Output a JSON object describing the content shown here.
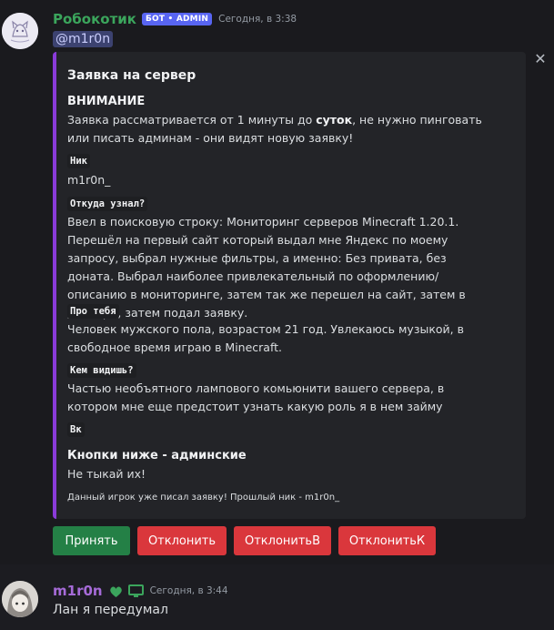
{
  "message1": {
    "username": "Робокотик",
    "bot_tag": "БОТ • ADMIN",
    "timestamp": "Сегодня, в 3:38",
    "mention": "@m1r0n",
    "username_color": "#3ba55c",
    "embed": {
      "accent_color": "#8a3bd9",
      "title": "Заявка на сервер",
      "warning_heading": "ВНИМАНИЕ",
      "warning_pre": "Заявка рассматривается от 1 минуты до ",
      "warning_bold": "суток",
      "warning_post": ", не нужно пинговать или писать админам - они видят новую заявку!",
      "fields": [
        {
          "name": "Ник",
          "value": "m1r0n_"
        },
        {
          "name": "Откуда узнал?",
          "value": "Ввел в поисковую строку: Мониторинг серверов Minecraft 1.20.1. Перешёл на первый сайт который выдал мне Яндекс по моему запросу, выбрал нужные фильтры, а именно: Без привата, без доната. Выбрал наиболее привлекательный по оформлению/описанию в мониторинге, затем так же перешел на сайт, затем в дискорд, затем подал заявку."
        },
        {
          "name": "Про тебя",
          "value": "Человек мужского пола, возрастом 21 год. Увлекаюсь музыкой, в свободное время играю в Minecraft."
        },
        {
          "name": "Кем видишь?",
          "value": "Частью необъятного лампового комьюнити вашего сервера, в котором мне еще предстоит узнать какую роль я в нем займу"
        },
        {
          "name": "Вк",
          "value": ""
        }
      ],
      "admin_heading": "Кнопки ниже - админские",
      "admin_text": "Не тыкай их!",
      "footer": "Данный игрок уже писал заявку! Прошлый ник - m1r0n_"
    },
    "buttons": [
      {
        "label": "Принять",
        "color": "#248046"
      },
      {
        "label": "Отклонить",
        "color": "#da373c"
      },
      {
        "label": "ОтклонитьВ",
        "color": "#da373c"
      },
      {
        "label": "ОтклонитьК",
        "color": "#da373c"
      }
    ]
  },
  "message2": {
    "username": "m1r0n",
    "username_color": "#a66bd8",
    "badge_icons": [
      "leaf-badge-icon",
      "desktop-icon"
    ],
    "timestamp": "Сегодня, в 3:44",
    "text": "Лан я передумал"
  }
}
